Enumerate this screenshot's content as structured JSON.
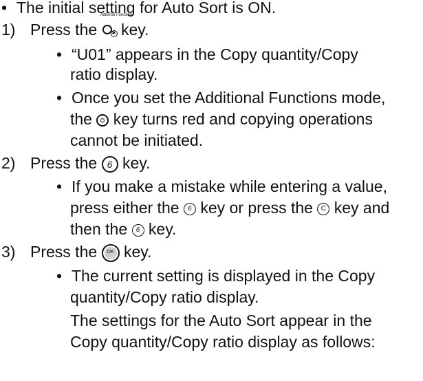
{
  "intro_bullet": "The initial setting for Auto Sort is ON.",
  "step1": {
    "num": "1)",
    "pre": "Press the",
    "post": "key.",
    "icon_label": "Adtional Function",
    "bullet_a": "“U01” appears in the Copy quantity/Copy",
    "bullet_a2": "ratio display.",
    "bullet_b1": "Once you set the Additional Functions mode,",
    "bullet_b2_pre": "the",
    "bullet_b2_post": "key turns red and copying operations",
    "bullet_b3": "cannot be initiated."
  },
  "step2": {
    "num": "2)",
    "pre": "Press the",
    "post": "key.",
    "key_digit": "6",
    "bullet1": "If you make a mistake while entering a value,",
    "bullet2_pre": "press either the",
    "bullet2_mid": "key or press the",
    "bullet2_post": "key and",
    "key_c": "C",
    "bullet3_pre": "then the",
    "bullet3_post": "key."
  },
  "step3": {
    "num": "3)",
    "pre": "Press the",
    "post": "key.",
    "ok_label": "OK",
    "bullet1": "The current setting is displayed in the Copy",
    "bullet2": "quantity/Copy ratio display.",
    "line3": "The settings for the Auto Sort appear in the",
    "line4": "Copy quantity/Copy ratio display as follows:"
  },
  "bullet_char": "•"
}
